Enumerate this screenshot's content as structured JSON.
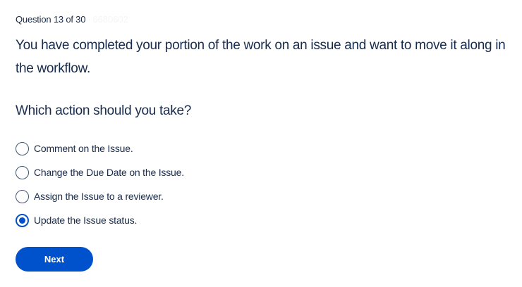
{
  "header": {
    "counter": "Question 13 of 30",
    "question_id": "6680602"
  },
  "question": {
    "text": "You have completed your portion of the work on an issue and want to move it along in the workflow.",
    "prompt": "Which action should you take?"
  },
  "options": [
    {
      "label": "Comment on the Issue.",
      "selected": false
    },
    {
      "label": "Change the Due Date on the Issue.",
      "selected": false
    },
    {
      "label": "Assign the Issue to a reviewer.",
      "selected": false
    },
    {
      "label": "Update the Issue status.",
      "selected": true
    }
  ],
  "actions": {
    "next_label": "Next"
  },
  "colors": {
    "accent": "#0052cc",
    "text": "#172b4d",
    "radio_border": "#42526e",
    "faint_id": "#f3f5f8"
  }
}
